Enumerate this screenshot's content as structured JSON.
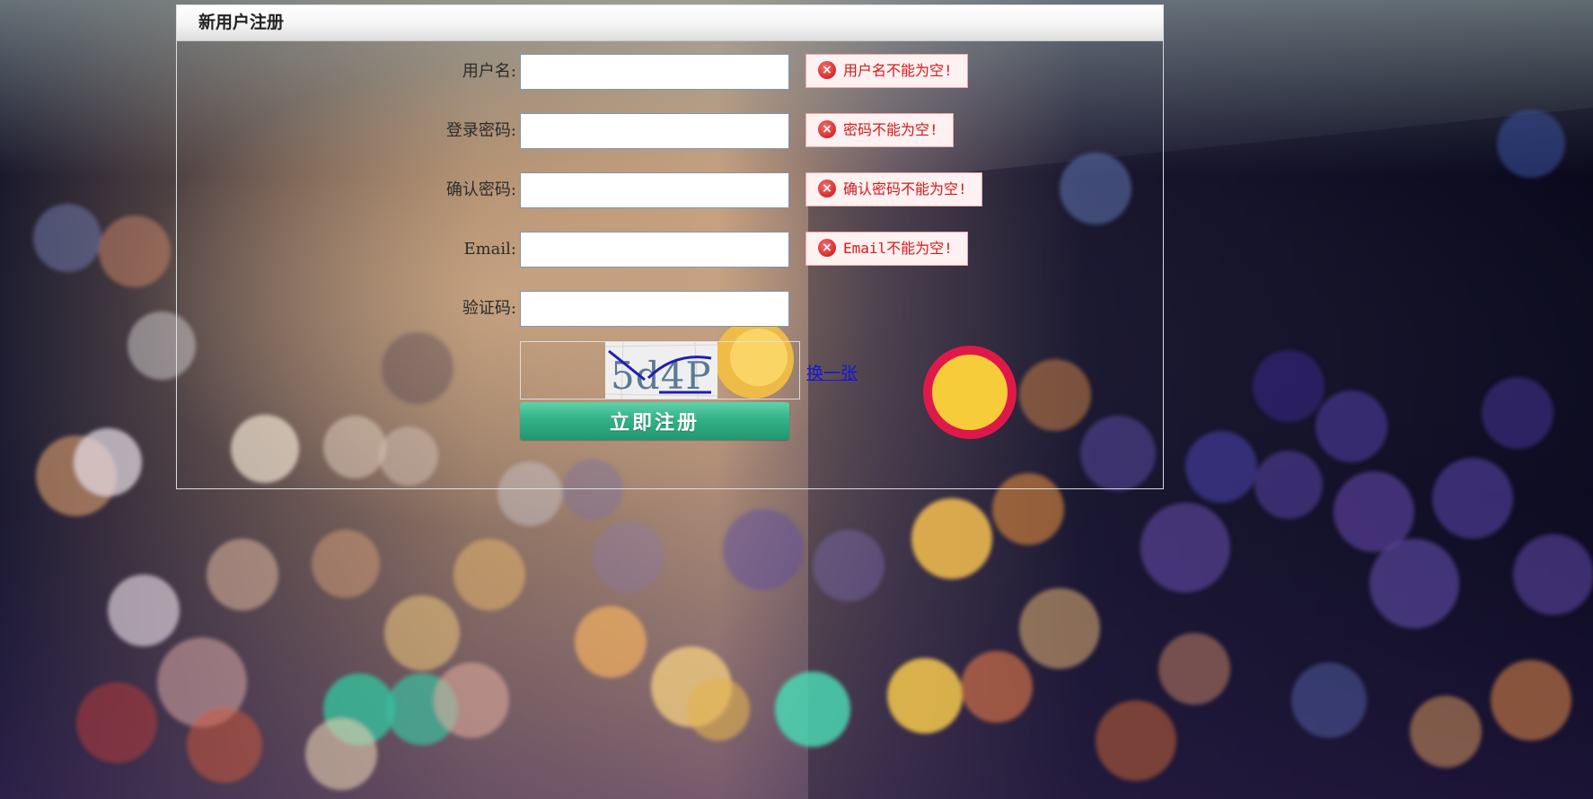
{
  "form": {
    "title": "新用户注册",
    "username": {
      "label": "用户名:",
      "value": "",
      "error": "用户名不能为空!"
    },
    "password": {
      "label": "登录密码:",
      "value": "",
      "error": "密码不能为空!"
    },
    "confirm_password": {
      "label": "确认密码:",
      "value": "",
      "error": "确认密码不能为空!"
    },
    "email": {
      "label": "Email:",
      "value": "",
      "error": "Email不能为空!"
    },
    "captcha": {
      "label": "验证码:",
      "value": "",
      "image_text": "5d4P",
      "refresh_link": "换一张"
    },
    "submit_label": "立即注册"
  },
  "colors": {
    "error_text": "#d41a1a",
    "error_border": "#e9a9a9",
    "error_bg": "#fdf1f1",
    "submit_button": "#2fae84",
    "link": "#1515dd"
  },
  "icons": {
    "error": "error-circle-x-icon"
  }
}
